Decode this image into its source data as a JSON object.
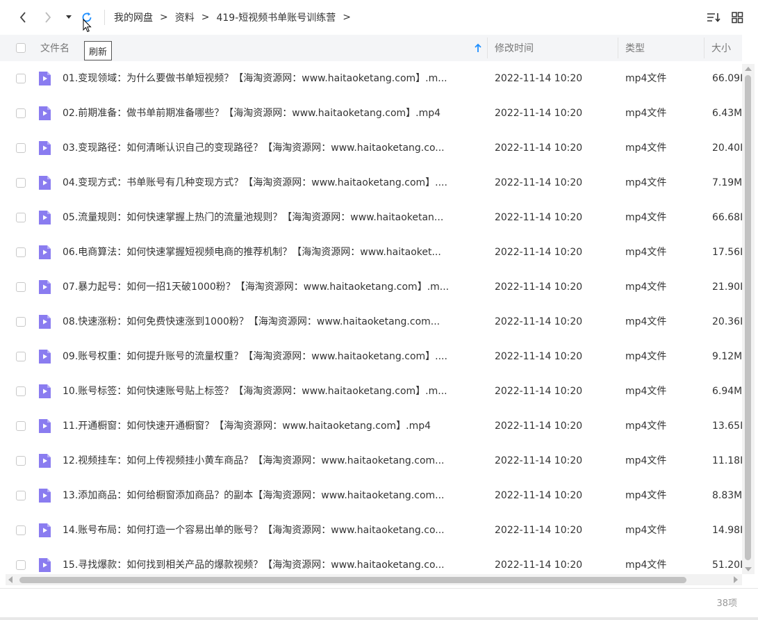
{
  "toolbar": {
    "back_icon": "chevron-left-icon",
    "forward_icon": "chevron-right-icon",
    "dropdown_icon": "caret-down-icon",
    "refresh_icon": "refresh-icon",
    "sort_icon": "sort-list-icon",
    "grid_icon": "grid-view-icon",
    "refresh_tooltip": "刷新"
  },
  "breadcrumb": [
    {
      "label": "我的网盘"
    },
    {
      "label": "资料"
    },
    {
      "label": "419-短视频书单账号训练营"
    }
  ],
  "breadcrumb_separator": ">",
  "columns": {
    "name": "文件名",
    "modified": "修改时间",
    "type": "类型",
    "size": "大小"
  },
  "colors": {
    "accent": "#1e8fff",
    "file_icon": "#8a7cf0"
  },
  "files": [
    {
      "name": "01.变现领域：为什么要做书单短视频？【海淘资源网：www.haitaoketang.com】.m...",
      "modified": "2022-11-14 10:20",
      "type": "mp4文件",
      "size": "66.09I"
    },
    {
      "name": "02.前期准备：做书单前期准备哪些？【海淘资源网：www.haitaoketang.com】.mp4",
      "modified": "2022-11-14 10:20",
      "type": "mp4文件",
      "size": "6.43M"
    },
    {
      "name": "03.变现路径：如何清晰认识自己的变现路径？【海淘资源网：www.haitaoketang.co...",
      "modified": "2022-11-14 10:20",
      "type": "mp4文件",
      "size": "20.40I"
    },
    {
      "name": "04.变现方式：书单账号有几种变现方式？【海淘资源网：www.haitaoketang.com】....",
      "modified": "2022-11-14 10:20",
      "type": "mp4文件",
      "size": "7.19M"
    },
    {
      "name": "05.流量规则：如何快速掌握上热门的流量池规则？【海淘资源网：www.haitaoketan...",
      "modified": "2022-11-14 10:20",
      "type": "mp4文件",
      "size": "66.68I"
    },
    {
      "name": "06.电商算法：如何快速掌握短视频电商的推荐机制？【海淘资源网：www.haitaoket...",
      "modified": "2022-11-14 10:20",
      "type": "mp4文件",
      "size": "17.56I"
    },
    {
      "name": "07.暴力起号：如何一招1天破1000粉？【海淘资源网：www.haitaoketang.com】.m...",
      "modified": "2022-11-14 10:20",
      "type": "mp4文件",
      "size": "21.90I"
    },
    {
      "name": "08.快速涨粉：如何免费快速涨到1000粉？【海淘资源网：www.haitaoketang.com...",
      "modified": "2022-11-14 10:20",
      "type": "mp4文件",
      "size": "20.36I"
    },
    {
      "name": "09.账号权重：如何提升账号的流量权重？【海淘资源网：www.haitaoketang.com】....",
      "modified": "2022-11-14 10:20",
      "type": "mp4文件",
      "size": "9.12M"
    },
    {
      "name": "10.账号标签：如何快速账号贴上标签？【海淘资源网：www.haitaoketang.com】.m...",
      "modified": "2022-11-14 10:20",
      "type": "mp4文件",
      "size": "6.94M"
    },
    {
      "name": "11.开通橱窗：如何快速开通橱窗？【海淘资源网：www.haitaoketang.com】.mp4",
      "modified": "2022-11-14 10:20",
      "type": "mp4文件",
      "size": "13.65I"
    },
    {
      "name": "12.视频挂车：如何上传视频挂小黄车商品？【海淘资源网：www.haitaoketang.com...",
      "modified": "2022-11-14 10:20",
      "type": "mp4文件",
      "size": "11.18I"
    },
    {
      "name": "13.添加商品：如何给橱窗添加商品？的副本【海淘资源网：www.haitaoketang.com...",
      "modified": "2022-11-14 10:20",
      "type": "mp4文件",
      "size": "8.83M"
    },
    {
      "name": "14.账号布局：如何打造一个容易出单的账号？【海淘资源网：www.haitaoketang.co...",
      "modified": "2022-11-14 10:20",
      "type": "mp4文件",
      "size": "14.98I"
    },
    {
      "name": "15.寻找爆款：如何找到相关产品的爆款视频？【海淘资源网：www.haitaoketang.co...",
      "modified": "2022-11-14 10:20",
      "type": "mp4文件",
      "size": "51.20I"
    }
  ],
  "footer": {
    "count": "38项"
  }
}
